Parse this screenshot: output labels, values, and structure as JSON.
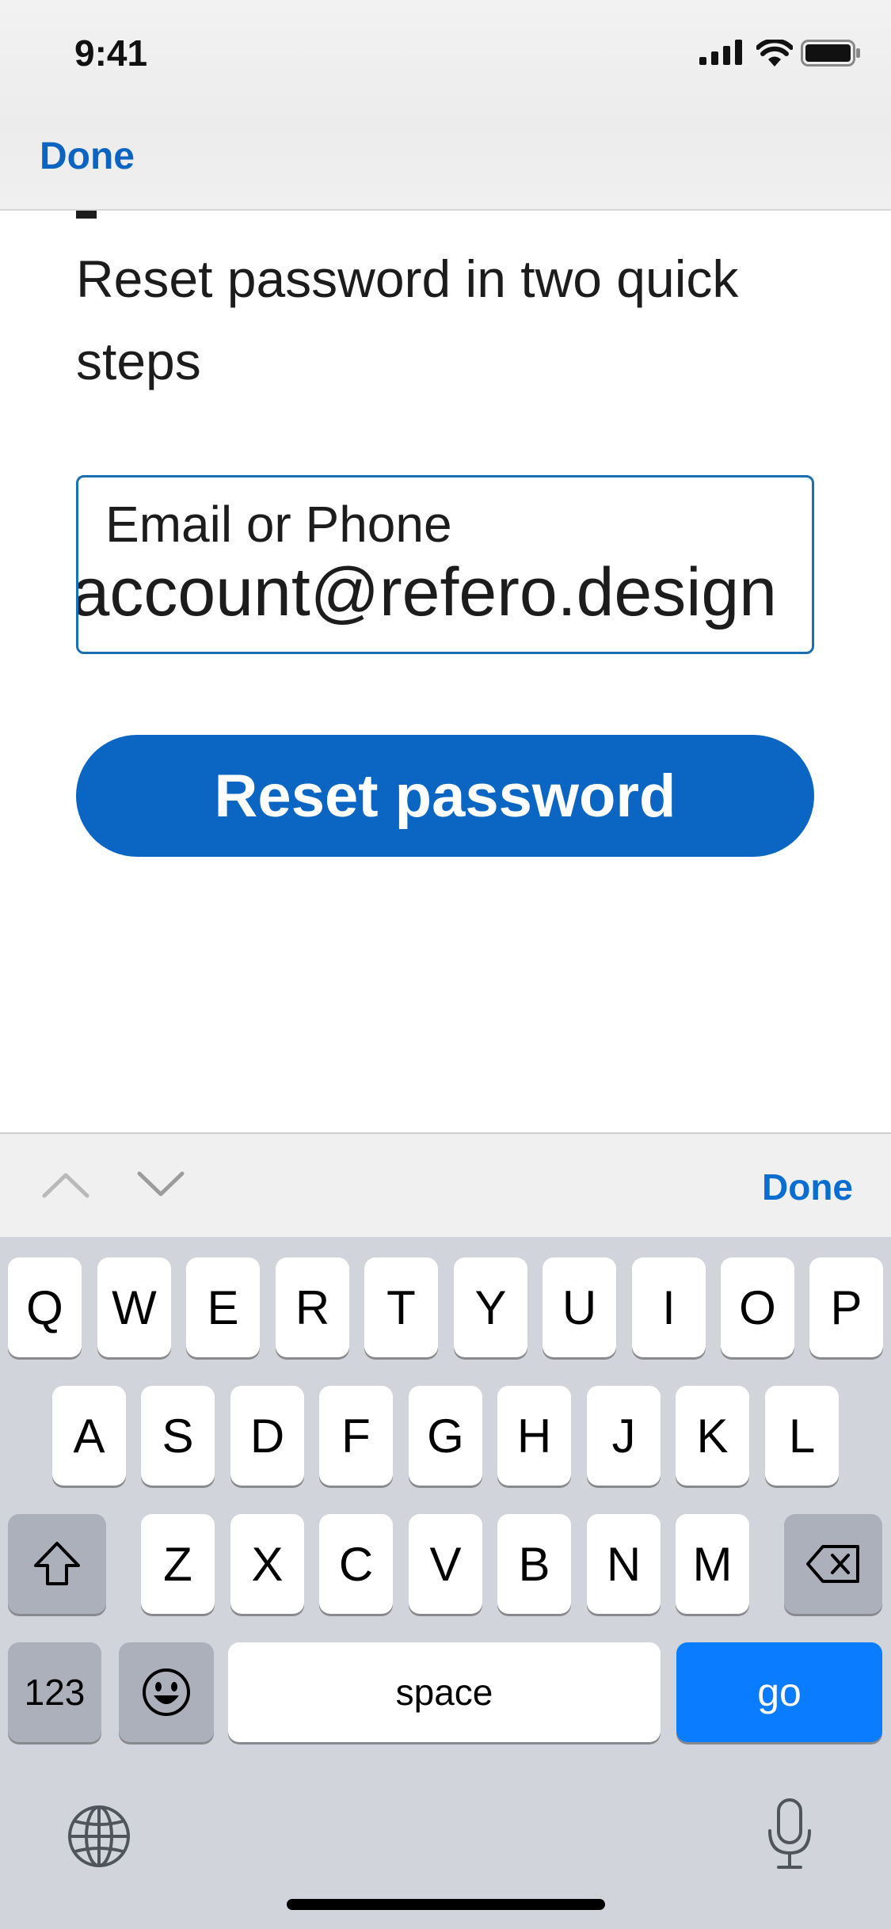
{
  "status_bar": {
    "time": "9:41",
    "icons": [
      "signal-icon",
      "wifi-icon",
      "battery-icon"
    ]
  },
  "nav": {
    "done_label": "Done"
  },
  "form": {
    "subtitle": "Reset password in two quick steps",
    "field_label": "Email or Phone",
    "field_value": "account@refero.design",
    "button_label": "Reset password",
    "accent_color": "#0a66c2"
  },
  "accessory": {
    "icons": [
      "chevron-up-icon",
      "chevron-down-icon"
    ],
    "done_label": "Done"
  },
  "keyboard": {
    "row1": [
      "Q",
      "W",
      "E",
      "R",
      "T",
      "Y",
      "U",
      "I",
      "O",
      "P"
    ],
    "row2": [
      "A",
      "S",
      "D",
      "F",
      "G",
      "H",
      "J",
      "K",
      "L"
    ],
    "row3": [
      "Z",
      "X",
      "C",
      "V",
      "B",
      "N",
      "M"
    ],
    "numbers_label": "123",
    "space_label": "space",
    "go_label": "go",
    "icons": [
      "shift-icon",
      "backspace-icon",
      "emoji-icon",
      "globe-icon",
      "microphone-icon"
    ],
    "go_color": "#0a7cff"
  }
}
